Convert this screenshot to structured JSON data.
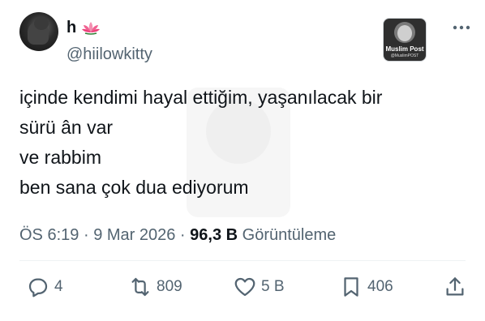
{
  "author": {
    "name": "h",
    "handle": "@hiilowkitty",
    "name_emoji_icon": "lotus-icon"
  },
  "badge": {
    "title": "Muslim Post",
    "subtitle": "@MuslimPOST"
  },
  "tweet": {
    "lines": [
      "içinde kendimi hayal ettiğim, yaşanılacak bir",
      "sürü ân var",
      "ve rabbim",
      "ben sana çok dua ediyorum"
    ]
  },
  "meta": {
    "time": "ÖS 6:19",
    "sep1": "·",
    "date": "9 Mar 2026",
    "sep2": "·",
    "views_count": "96,3 B",
    "views_label": "Görüntüleme"
  },
  "actions": {
    "replies": "4",
    "reposts": "809",
    "likes": "5 B",
    "bookmarks": "406"
  },
  "colors": {
    "text": "#0f1419",
    "secondary": "#536471",
    "divider": "#eff3f4"
  }
}
